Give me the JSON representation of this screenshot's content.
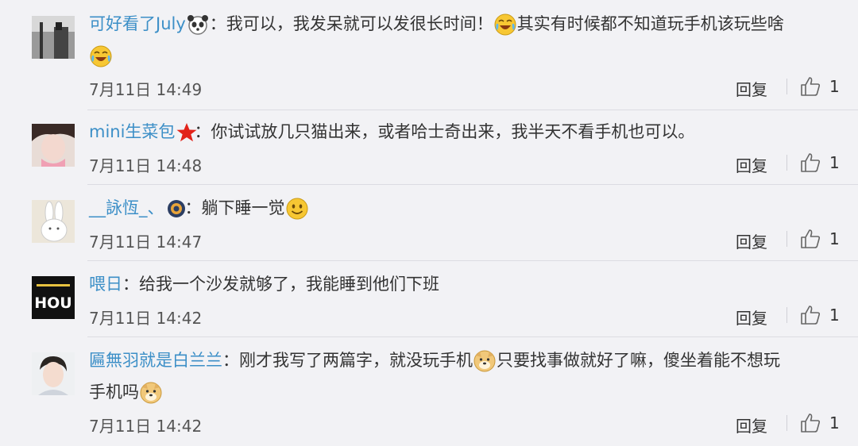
{
  "comments": [
    {
      "user": "可好看了July",
      "text": "：我可以，我发呆就可以发很长时间！",
      "text2": "其实有时候都不知道玩手机该玩些啥",
      "time": "7月11日 14:49",
      "reply_label": "回复",
      "likes": "1",
      "badge_icon": "panda-icon",
      "emoji_icon": "laughing-tears-emoji"
    },
    {
      "user": "mini生菜包",
      "text": "：你试试放几只猫出来，或者哈士奇出来，我半天不看手机也可以。",
      "time": "7月11日 14:48",
      "reply_label": "回复",
      "likes": "1",
      "badge_icon": "red-star-icon"
    },
    {
      "user": "__詠恆_、",
      "text": "：躺下睡一觉",
      "time": "7月11日 14:47",
      "reply_label": "回复",
      "likes": "1",
      "badge_icon": "game-badge-icon",
      "emoji_icon": "smile-emoji"
    },
    {
      "user": "喂日",
      "text": "：给我一个沙发就够了，我能睡到他们下班",
      "time": "7月11日 14:42",
      "reply_label": "回复",
      "likes": "1",
      "avatar_text": "HOU"
    },
    {
      "user": "匾無羽就是白兰兰",
      "text": "：刚才我写了两篇字，就没玩手机",
      "text2": "只要找事做就好了嘛，傻坐着能不想玩",
      "text3": "手机吗",
      "time": "7月11日 14:42",
      "reply_label": "回复",
      "likes": "1",
      "emoji_icon": "doge-emoji"
    }
  ],
  "colors": {
    "username": "#3c8fc7",
    "background": "#f2f2f5",
    "text": "#333333"
  }
}
